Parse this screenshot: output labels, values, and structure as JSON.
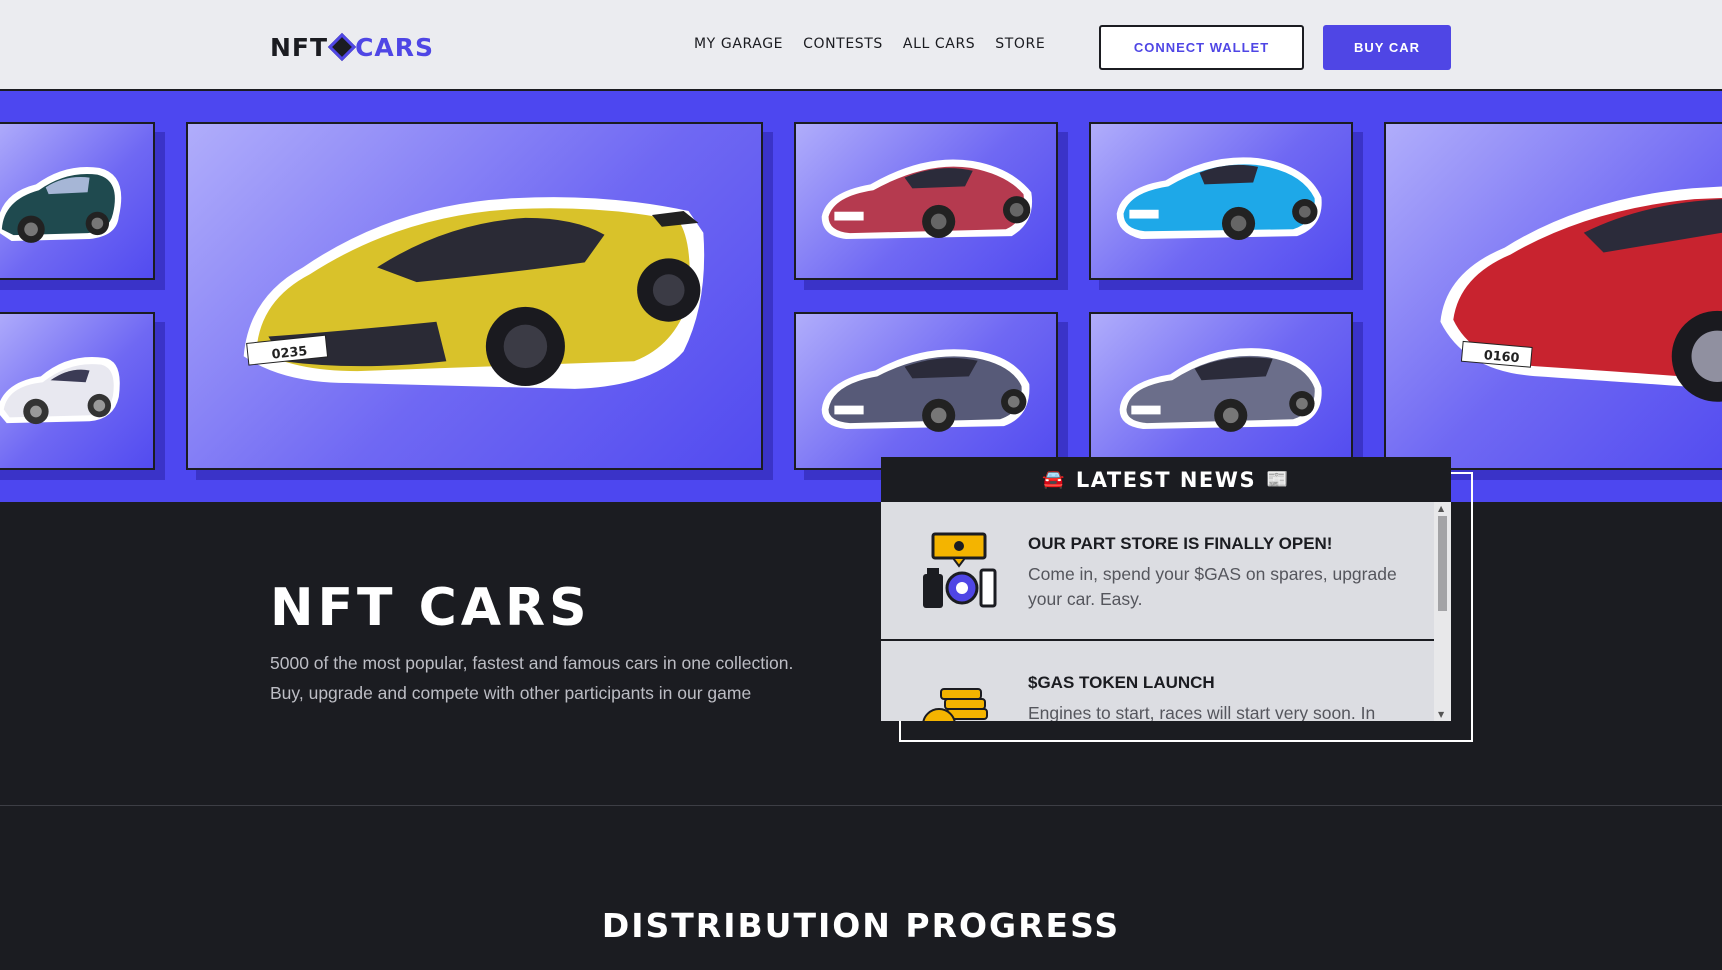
{
  "header": {
    "logo_left": "NFT",
    "logo_right": "CARS",
    "nav": [
      "MY GARAGE",
      "CONTESTS",
      "ALL CARS",
      "STORE"
    ],
    "connect_wallet": "CONNECT WALLET",
    "buy_car": "BUY CAR"
  },
  "gallery": {
    "plates": [
      "0235",
      "0160"
    ]
  },
  "hero": {
    "title": "NFT CARS",
    "subtitle_line1": "5000 of the most popular, fastest and famous cars in one collection.",
    "subtitle_line2": "Buy, upgrade and compete with other participants in our game"
  },
  "news": {
    "heading": "LATEST NEWS",
    "icon_left": "🚘",
    "icon_right": "📰",
    "items": [
      {
        "title": "OUR PART STORE IS FINALLY OPEN!",
        "text": "Come in, spend your $GAS on spares, upgrade your car. Easy."
      },
      {
        "title": "$GAS TOKEN LAUNCH",
        "text": "Engines to start, races will start very soon. In"
      }
    ]
  },
  "distribution": {
    "title": "DISTRIBUTION PROGRESS"
  },
  "colors": {
    "accent": "#4f46e5",
    "dark": "#1b1c21",
    "header_bg": "#ebecf0",
    "gallery_bg": "#4d47f0"
  }
}
